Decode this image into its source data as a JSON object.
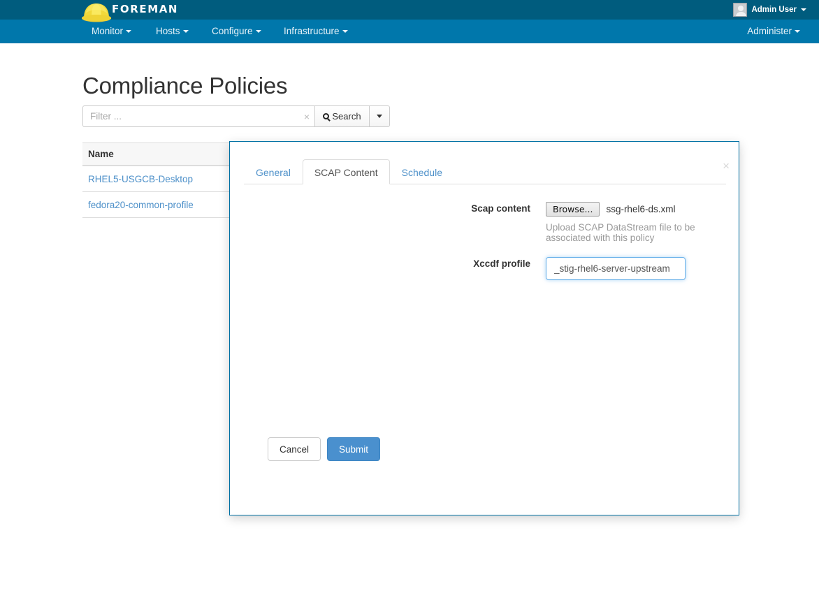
{
  "header": {
    "brand": "FOREMAN",
    "logo_icon": "hard-hat-icon",
    "nav": [
      {
        "label": "Monitor",
        "caret": true
      },
      {
        "label": "Hosts",
        "caret": true
      },
      {
        "label": "Configure",
        "caret": true
      },
      {
        "label": "Infrastructure",
        "caret": true
      }
    ],
    "administer": {
      "label": "Administer",
      "caret": true
    },
    "user": {
      "name": "Admin User",
      "avatar_icon": "user-avatar-icon",
      "caret": true
    }
  },
  "page": {
    "title": "Compliance Policies"
  },
  "search": {
    "placeholder": "Filter ...",
    "value": "",
    "clear_icon": "×",
    "search_label": "Search",
    "search_icon": "magnifier-icon",
    "dropdown_icon": "caret-down-icon"
  },
  "table": {
    "columns": [
      "Name"
    ],
    "rows": [
      {
        "name": "RHEL5-USGCB-Desktop"
      },
      {
        "name": "fedora20-common-profile"
      }
    ]
  },
  "modal": {
    "close_icon": "×",
    "tabs": [
      {
        "label": "General",
        "active": false
      },
      {
        "label": "SCAP Content",
        "active": true
      },
      {
        "label": "Schedule",
        "active": false
      }
    ],
    "fields": {
      "scap_content": {
        "label": "Scap content",
        "browse_label": "Browse...",
        "file_name": "ssg-rhel6-ds.xml",
        "help": "Upload SCAP DataStream file to be associated with this policy"
      },
      "xccdf_profile": {
        "label": "Xccdf profile",
        "value": "_stig-rhel6-server-upstream"
      }
    },
    "actions": {
      "cancel": "Cancel",
      "submit": "Submit"
    }
  },
  "colors": {
    "navbar_top": "#005c7e",
    "navbar_main": "#0077ab",
    "link": "#4d90c9",
    "primary_button": "#4a90ce",
    "modal_border": "#0070a3",
    "focus_border": "#66afe9"
  }
}
